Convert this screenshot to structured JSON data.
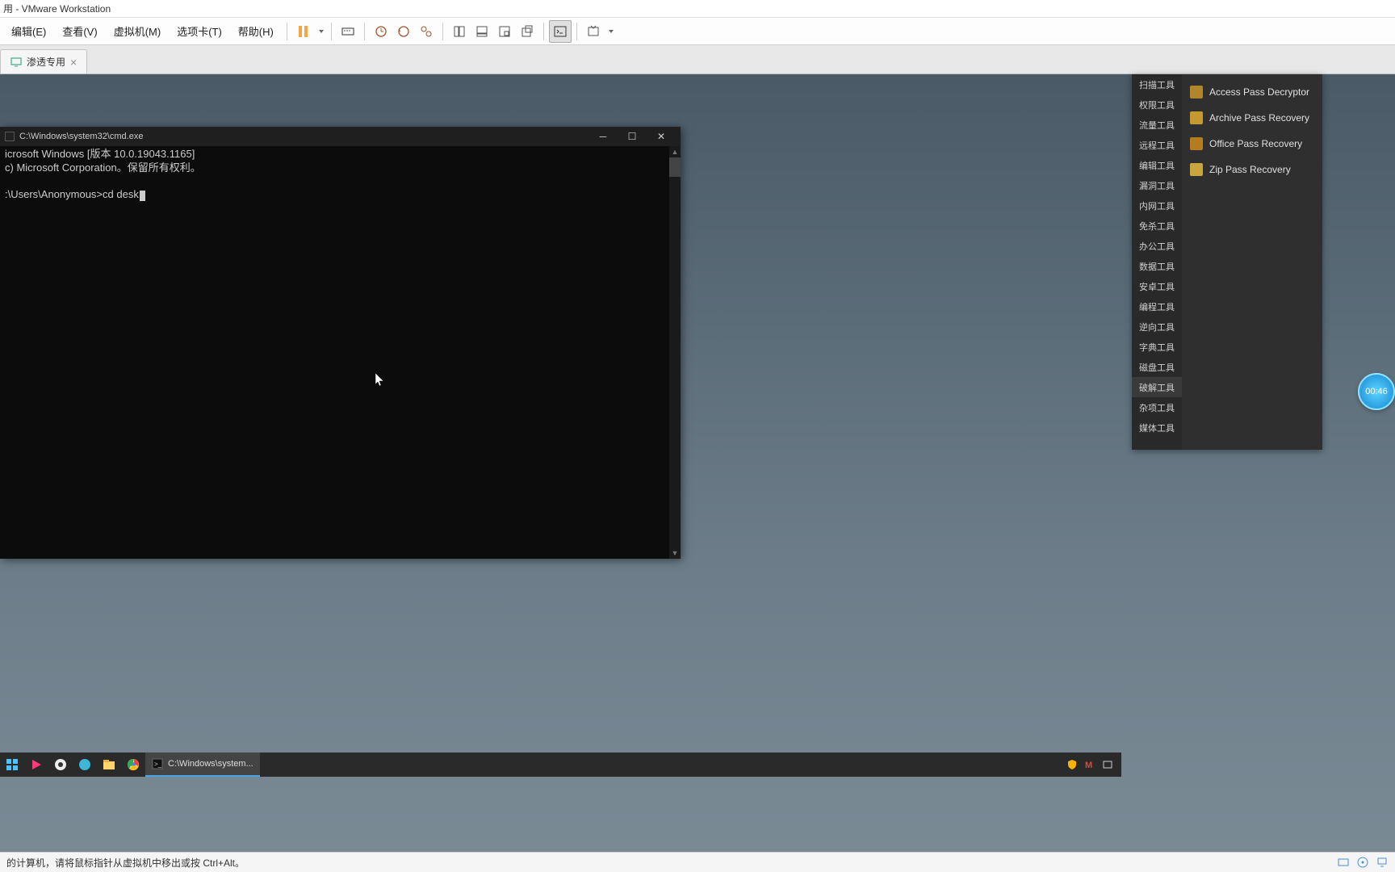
{
  "app": {
    "title": "用 - VMware Workstation"
  },
  "menu": {
    "edit": "编辑(E)",
    "view": "查看(V)",
    "vm": "虚拟机(M)",
    "tabs": "选项卡(T)",
    "help": "帮助(H)"
  },
  "tab": {
    "label": "渗透专用"
  },
  "cmd": {
    "title": "C:\\Windows\\system32\\cmd.exe",
    "line1": "icrosoft Windows [版本 10.0.19043.1165]",
    "line2": "c) Microsoft Corporation。保留所有权利。",
    "prompt": ":\\Users\\Anonymous>cd desk"
  },
  "tool_categories": [
    "扫描工具",
    "权限工具",
    "流量工具",
    "远程工具",
    "编辑工具",
    "漏洞工具",
    "内网工具",
    "免杀工具",
    "办公工具",
    "数据工具",
    "安卓工具",
    "编程工具",
    "逆向工具",
    "字典工具",
    "磁盘工具",
    "破解工具",
    "杂项工具",
    "媒体工具"
  ],
  "tool_active_index": 15,
  "tool_items": [
    "Access Pass Decryptor",
    "Archive Pass Recovery",
    "Office Pass Recovery",
    "Zip Pass Recovery"
  ],
  "timer": "00:46",
  "taskbar": {
    "cmd_label": "C:\\Windows\\system..."
  },
  "statusbar": {
    "msg": "的计算机，请将鼠标指针从虚拟机中移出或按 Ctrl+Alt。"
  }
}
